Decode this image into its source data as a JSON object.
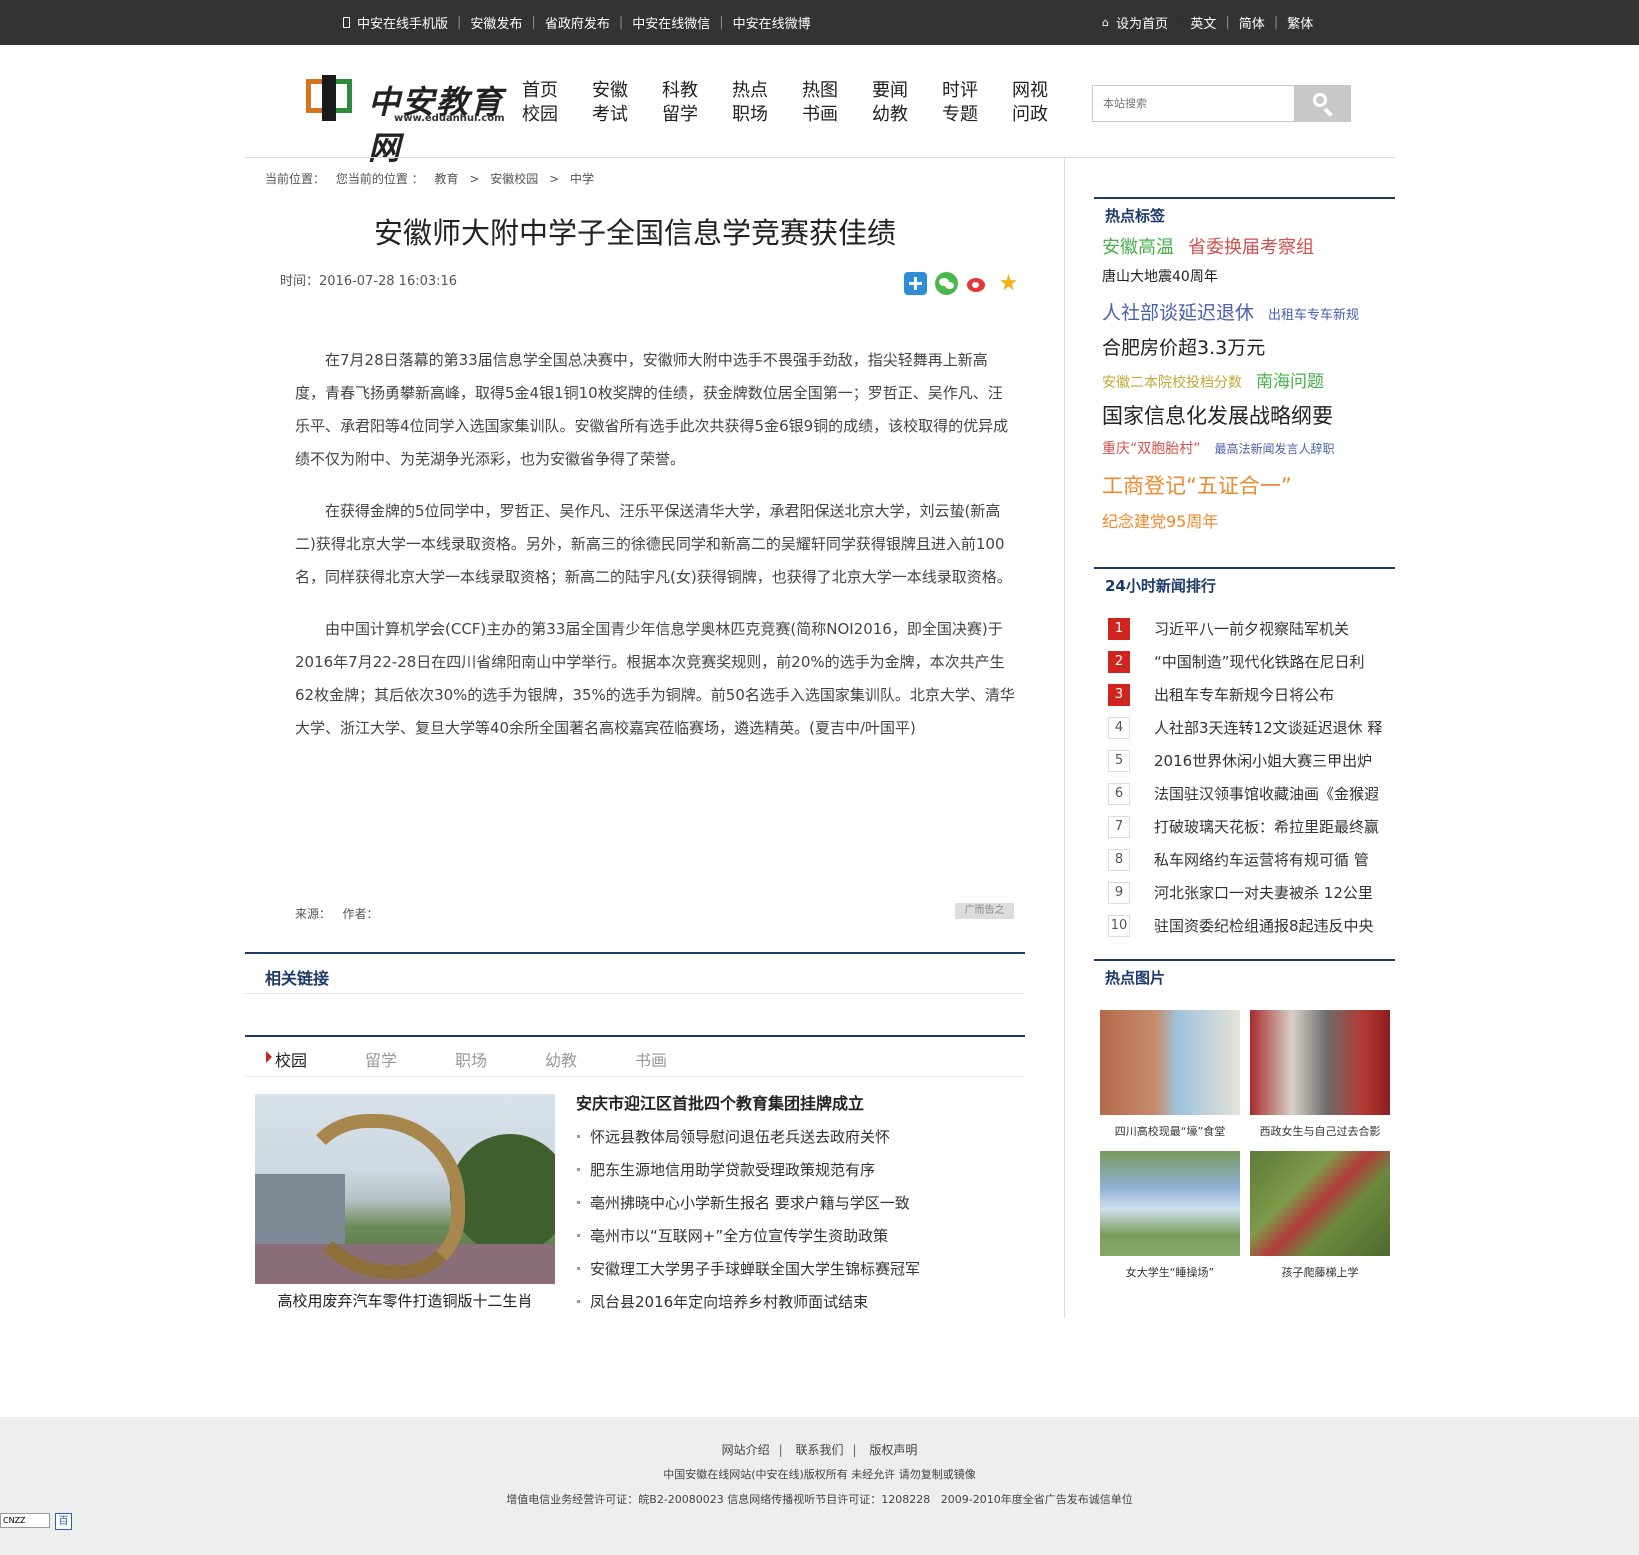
{
  "topbar": {
    "left_links": [
      "中安在线手机版",
      "安徽发布",
      "省政府发布",
      "中安在线微信",
      "中安在线微博"
    ],
    "right_links": [
      "设为首页",
      "英文",
      "简体",
      "繁体"
    ]
  },
  "logo": {
    "name": "中安教育网",
    "url": "www.eduanhui.com"
  },
  "nav": [
    [
      "首页",
      "校园"
    ],
    [
      "安徽",
      "考试"
    ],
    [
      "科教",
      "留学"
    ],
    [
      "热点",
      "职场"
    ],
    [
      "热图",
      "书画"
    ],
    [
      "要闻",
      "幼教"
    ],
    [
      "时评",
      "专题"
    ],
    [
      "网视",
      "问政"
    ]
  ],
  "search": {
    "placeholder": "本站搜索"
  },
  "breadcrumb": [
    "当前位置：",
    "您当前的位置 ：",
    "教育",
    ">",
    "安徽校园",
    ">",
    "中学"
  ],
  "article": {
    "title": "安徽师大附中学子全国信息学竞赛获佳绩",
    "time": "时间：2016-07-28 16:03:16",
    "paragraphs": [
      "在7月28日落幕的第33届信息学全国总决赛中，安徽师大附中选手不畏强手劲敌，指尖轻舞再上新高度，青春飞扬勇攀新高峰，取得5金4银1铜10枚奖牌的佳绩，获金牌数位居全国第一；罗哲正、吴作凡、汪乐平、承君阳等4位同学入选国家集训队。安徽省所有选手此次共获得5金6银9铜的成绩，该校取得的优异成绩不仅为附中、为芜湖争光添彩，也为安徽省争得了荣誉。",
      "在获得金牌的5位同学中，罗哲正、吴作凡、汪乐平保送清华大学，承君阳保送北京大学，刘云蛰(新高二)获得北京大学一本线录取资格。另外，新高三的徐德民同学和新高二的吴耀轩同学获得银牌且进入前100名，同样获得北京大学一本线录取资格；新高二的陆宇凡(女)获得铜牌，也获得了北京大学一本线录取资格。",
      "由中国计算机学会(CCF)主办的第33届全国青少年信息学奥林匹克竞赛(简称NOI2016，即全国决赛)于2016年7月22-28日在四川省绵阳南山中学举行。根据本次竞赛奖规则，前20%的选手为金牌，本次共产生62枚金牌；其后依次30%的选手为银牌，35%的选手为铜牌。前50名选手入选国家集训队。北京大学、清华大学、浙江大学、复旦大学等40余所全国著名高校嘉宾莅临赛场，遴选精英。(夏吉中/叶国平)"
    ],
    "source": "来源：   作者：",
    "ad": "广而告之"
  },
  "related": {
    "title": "相关链接"
  },
  "tabs": [
    "校园",
    "留学",
    "职场",
    "幼教",
    "书画"
  ],
  "campus": {
    "image_caption": "高校用废弃汽车零件打造铜版十二生肖",
    "headline": "安庆市迎江区首批四个教育集团挂牌成立",
    "items": [
      "怀远县教体局领导慰问退伍老兵送去政府关怀",
      "肥东生源地信用助学贷款受理政策规范有序",
      "亳州拂晓中心小学新生报名 要求户籍与学区一致",
      "亳州市以“互联网+”全方位宣传学生资助政策",
      "安徽理工大学男子手球蝉联全国大学生锦标赛冠军",
      "凤台县2016年定向培养乡村教师面试结束"
    ]
  },
  "sidebar": {
    "tags_title": "热点标签",
    "tags": [
      [
        {
          "t": "安徽高温",
          "c": "#46b04a",
          "s": 18
        },
        {
          "t": "省委换届考察组",
          "c": "#d0524e",
          "s": 18
        }
      ],
      [
        {
          "t": "唐山大地震40周年",
          "c": "#222222",
          "s": 14
        }
      ],
      [
        {
          "t": "人社部谈延迟退休",
          "c": "#4a5fb0",
          "s": 19
        },
        {
          "t": "出租车专车新规",
          "c": "#4a5fb0",
          "s": 13
        }
      ],
      [
        {
          "t": "合肥房价超3.3万元",
          "c": "#222222",
          "s": 19
        }
      ],
      [
        {
          "t": "安徽二本院校投档分数",
          "c": "#c2a836",
          "s": 14
        },
        {
          "t": "南海问题",
          "c": "#46b04a",
          "s": 17
        }
      ],
      [
        {
          "t": "国家信息化发展战略纲要",
          "c": "#222222",
          "s": 21
        }
      ],
      [
        {
          "t": "重庆“双胞胎村”",
          "c": "#d0524e",
          "s": 14
        },
        {
          "t": "最高法新闻发言人辞职",
          "c": "#4a5fb0",
          "s": 12
        }
      ],
      [
        {
          "t": "工商登记“五证合一”",
          "c": "#f08a2c",
          "s": 21
        }
      ],
      [
        {
          "t": "纪念建党95周年",
          "c": "#f08a2c",
          "s": 16
        }
      ]
    ],
    "rank_title": "24小时新闻排行",
    "rank": [
      {
        "n": "1",
        "t": "习近平八一前夕视察陆军机关"
      },
      {
        "n": "2",
        "t": "“中国制造”现代化铁路在尼日利"
      },
      {
        "n": "3",
        "t": "出租车专车新规今日将公布"
      },
      {
        "n": "4",
        "t": "人社部3天连转12文谈延迟退休 释"
      },
      {
        "n": "5",
        "t": "2016世界休闲小姐大赛三甲出炉"
      },
      {
        "n": "6",
        "t": "法国驻汉领事馆收藏油画《金猴遐"
      },
      {
        "n": "7",
        "t": "打破玻璃天花板：希拉里距最终赢"
      },
      {
        "n": "8",
        "t": "私车网络约车运营将有规可循 管"
      },
      {
        "n": "9",
        "t": "河北张家口一对夫妻被杀 12公里"
      },
      {
        "n": "10",
        "t": "驻国资委纪检组通报8起违反中央"
      }
    ],
    "pics_title": "热点图片",
    "pics": [
      "四川高校现最“壕”食堂",
      "西政女生与自己过去合影",
      "女大学生“睡操场”",
      "孩子爬藤梯上学"
    ]
  },
  "footer": {
    "links": [
      "网站介绍",
      "联系我们",
      "版权声明"
    ],
    "copyright": "中国安徽在线网站(中安在线)版权所有 未经允许 请勿复制或镜像",
    "license": "增值电信业务经营许可证：皖B2-20080023 信息网络传播视听节目许可证：1208228   2009-2010年度全省广告发布诚信单位"
  },
  "badges": {
    "cnzz": "CNZZ",
    "baidu": "百"
  }
}
